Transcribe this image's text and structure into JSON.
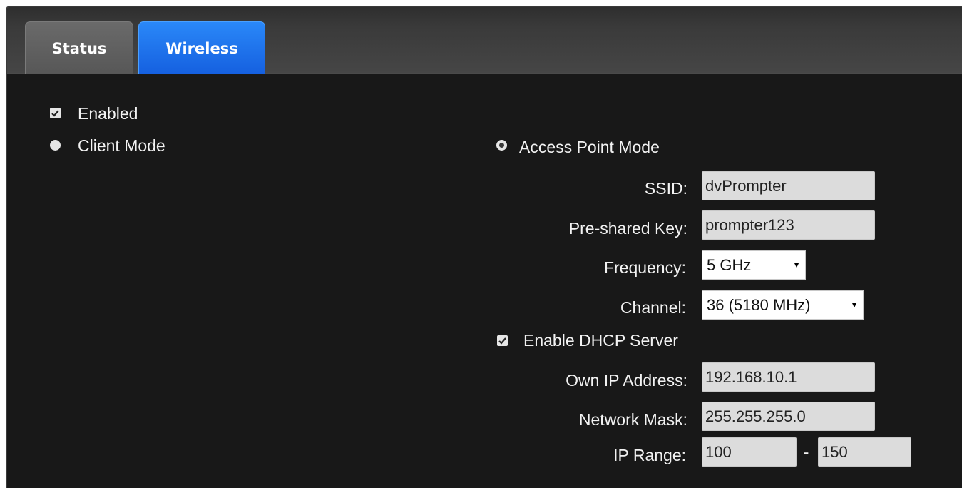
{
  "tabs": [
    {
      "label": "Status",
      "active": false
    },
    {
      "label": "Wireless",
      "active": true
    }
  ],
  "enabled": {
    "label": "Enabled",
    "checked": true
  },
  "modes": {
    "client": {
      "label": "Client Mode",
      "selected": false
    },
    "ap": {
      "label": "Access Point Mode",
      "selected": true
    }
  },
  "ap": {
    "ssid": {
      "label": "SSID:",
      "value": "dvPrompter"
    },
    "psk": {
      "label": "Pre-shared Key:",
      "value": "prompter123"
    },
    "frequency": {
      "label": "Frequency:",
      "value": "5 GHz"
    },
    "channel": {
      "label": "Channel:",
      "value": "36 (5180 MHz)"
    }
  },
  "dhcp": {
    "enable": {
      "label": "Enable DHCP Server",
      "checked": true
    },
    "own_ip": {
      "label": "Own IP Address:",
      "value": "192.168.10.1"
    },
    "mask": {
      "label": "Network Mask:",
      "value": "255.255.255.0"
    },
    "range": {
      "label": "IP Range:",
      "start": "100",
      "separator": "-",
      "end": "150"
    }
  },
  "colors": {
    "active_tab": "#1a6ff0",
    "background": "#181818",
    "field": "#dcdcdc"
  }
}
